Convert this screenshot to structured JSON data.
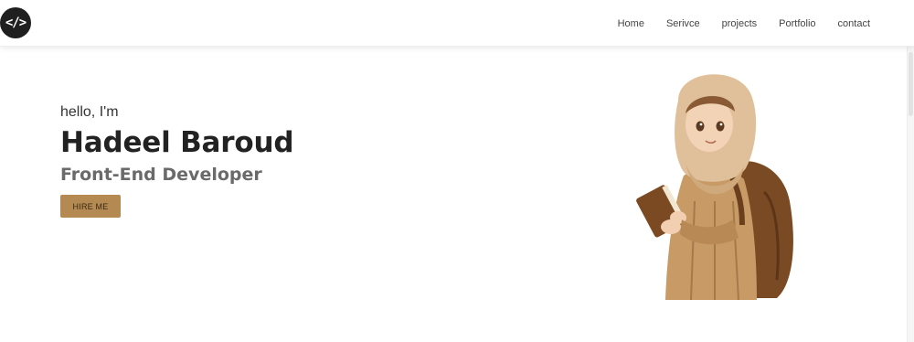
{
  "header": {
    "logo_text": "</>",
    "nav": [
      "Home",
      "Serivce",
      "projects",
      "Portfolio",
      "contact"
    ]
  },
  "hero": {
    "greeting": "hello, I'm",
    "name": "Hadeel Baroud",
    "role": "Front-End Developer",
    "cta_label": "HIRE ME"
  },
  "colors": {
    "accent": "#b48a52",
    "logo_bg": "#1f1f1f",
    "nav_text": "#444444",
    "name_text": "#222222",
    "role_text": "#6a6a6a"
  },
  "icons": {
    "logo": "code-brackets-icon"
  }
}
